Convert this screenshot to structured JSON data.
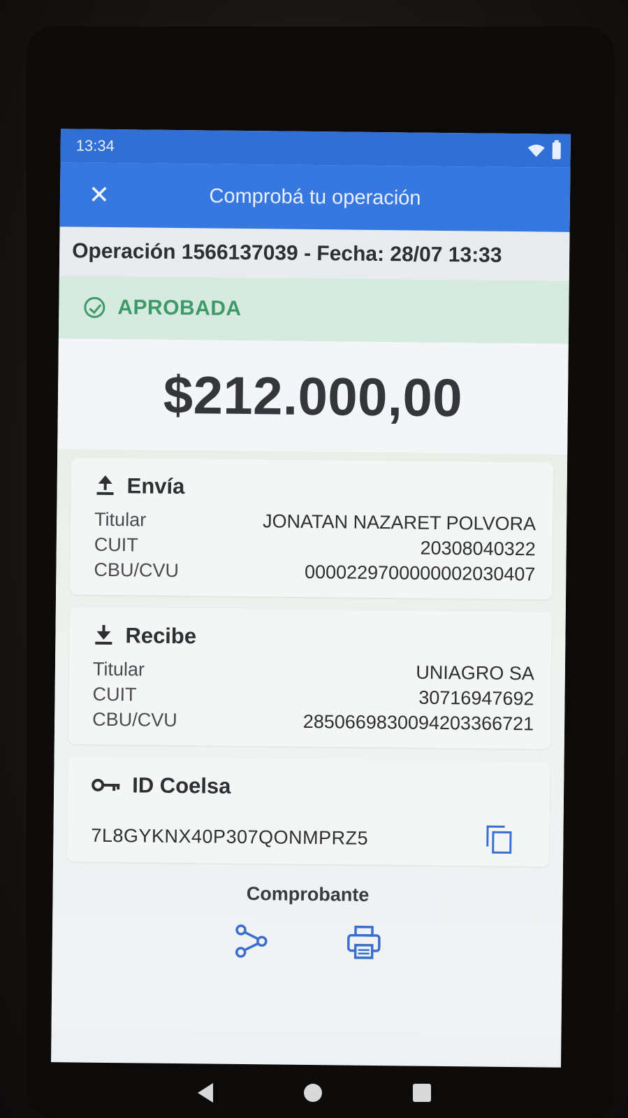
{
  "statusbar": {
    "time": "13:34"
  },
  "appbar": {
    "close_icon": "close-icon",
    "title": "Comprobá tu operación"
  },
  "operation": {
    "header": "Operación 1566137039 - Fecha: 28/07 13:33"
  },
  "status": {
    "icon": "check-circle-icon",
    "label": "APROBADA",
    "color": "#3f9a6a"
  },
  "amount": "$212.000,00",
  "sender": {
    "title": "Envía",
    "icon": "upload-icon",
    "rows": [
      {
        "key": "Titular",
        "value": "JONATAN NAZARET POLVORA"
      },
      {
        "key": "CUIT",
        "value": "20308040322"
      },
      {
        "key": "CBU/CVU",
        "value": "0000229700000002030407"
      }
    ]
  },
  "receiver": {
    "title": "Recibe",
    "icon": "download-icon",
    "rows": [
      {
        "key": "Titular",
        "value": "UNIAGRO SA"
      },
      {
        "key": "CUIT",
        "value": "30716947692"
      },
      {
        "key": "CBU/CVU",
        "value": "2850669830094203366721"
      }
    ]
  },
  "coelsa": {
    "title": "ID Coelsa",
    "icon": "key-icon",
    "value": "7L8GYKNX40P307QONMPRZ5",
    "copy_icon": "copy-icon"
  },
  "receipt": {
    "label": "Comprobante",
    "share_icon": "share-icon",
    "print_icon": "print-icon"
  },
  "colors": {
    "appbar": "#3677e0",
    "statusbar": "#2f6fd6",
    "accent_icon": "#3a6fd0"
  }
}
